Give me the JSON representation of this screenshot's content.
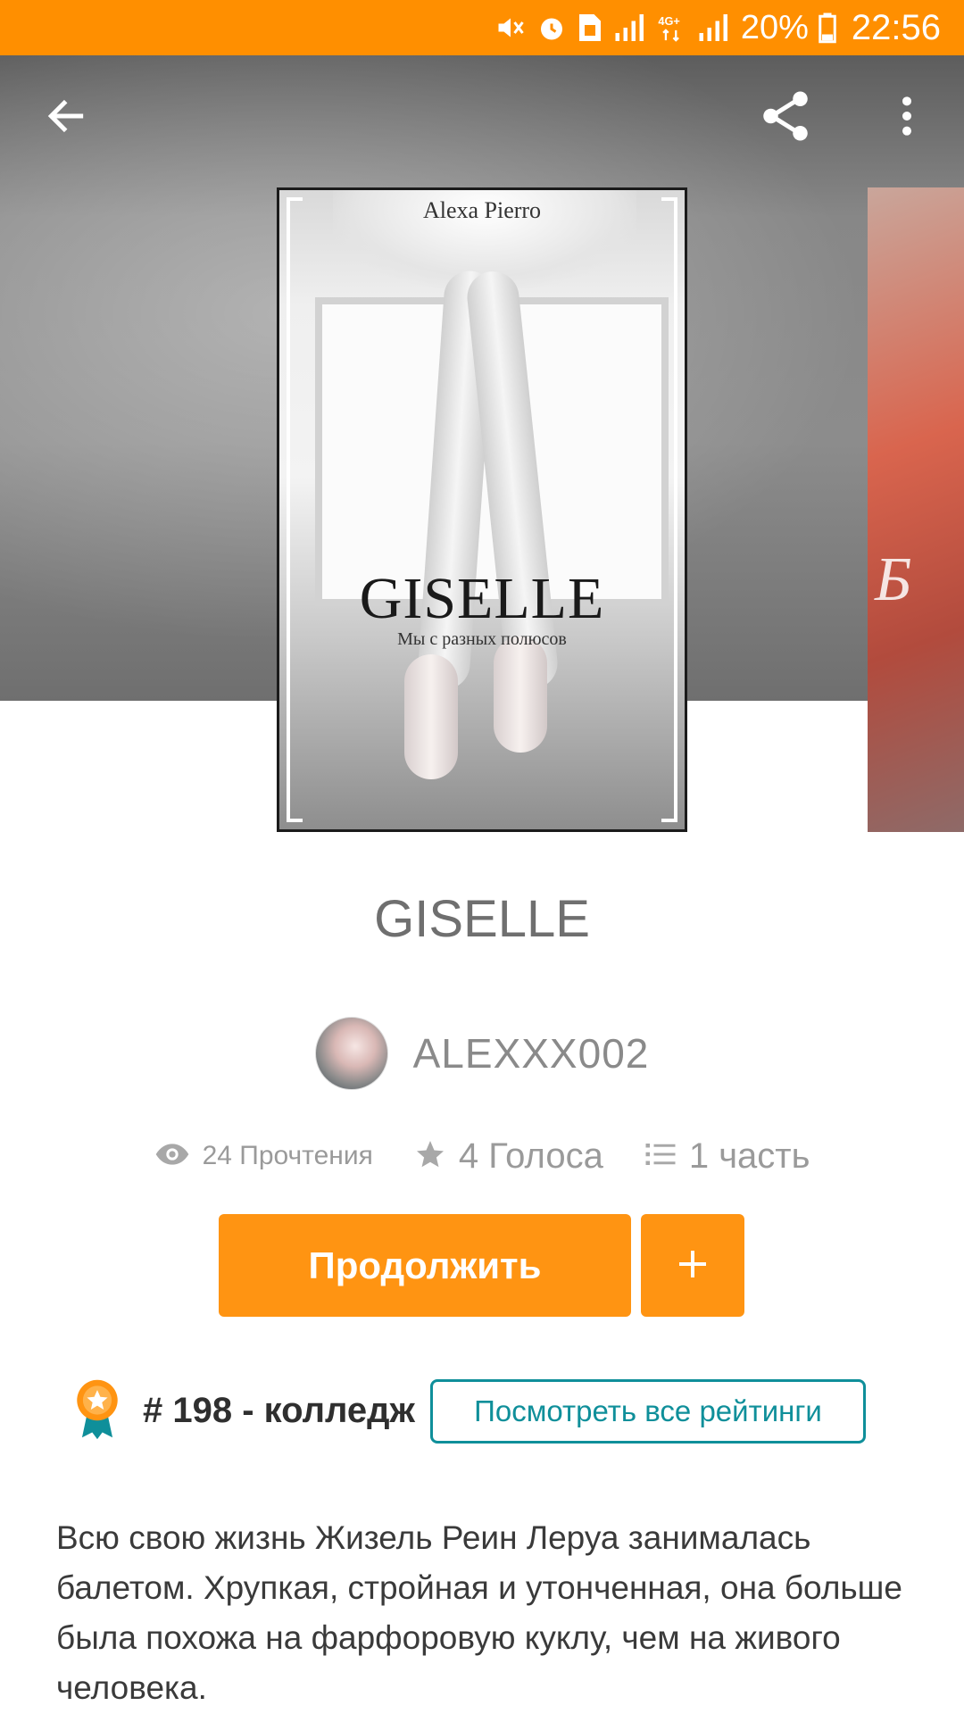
{
  "status_bar": {
    "battery_percent": "20%",
    "time": "22:56",
    "network": "4G"
  },
  "toolbar": {
    "back_icon": "arrow-left-icon",
    "share_icon": "share-icon",
    "more_icon": "more-vert-icon"
  },
  "cover": {
    "author": "Alexa Pierro",
    "title": "GISELLE",
    "subtitle": "Мы с разных полюсов"
  },
  "next_cover": {
    "text": "Б"
  },
  "story": {
    "title": "GISELLE",
    "author": "ALEXXX002",
    "reads": "24 Прочтения",
    "votes": "4 Голоса",
    "parts": "1 часть"
  },
  "actions": {
    "continue_label": "Продолжить",
    "add_label": "+"
  },
  "ranking": {
    "text": "# 198 - колледж",
    "view_all_label": "Посмотреть все рейтинги"
  },
  "description": "Всю свою жизнь Жизель Реин Леруа занималась балетом. Хрупкая, стройная и утонченная, она больше была похожа на фарфоровую куклу, чем на живого человека.",
  "colors": {
    "accent": "#ff9412",
    "status_bar": "#ff8f00",
    "teal": "#0f8f9a"
  }
}
